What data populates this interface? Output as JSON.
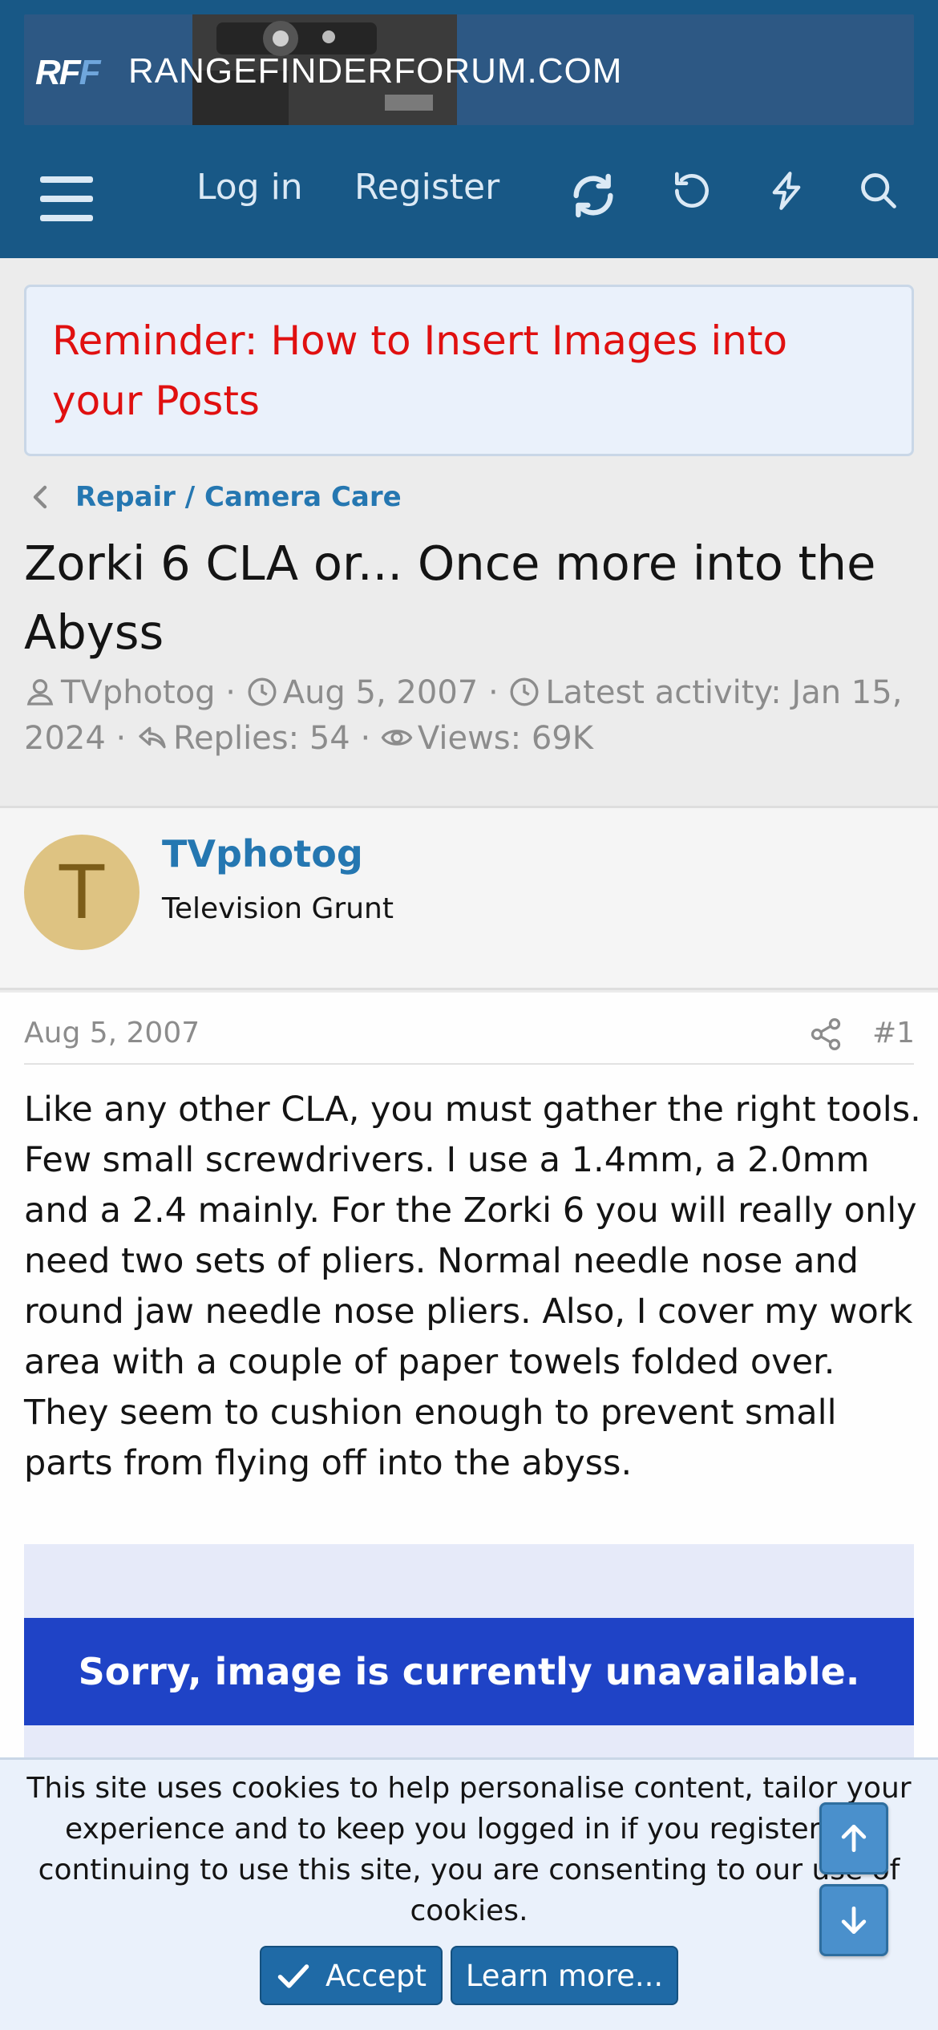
{
  "site": {
    "logo_text_r": "RF",
    "logo_text_f": "F",
    "name": "RANGEFINDERFORUM.COM"
  },
  "nav": {
    "login_label": "Log in",
    "register_label": "Register",
    "icons": [
      "menu-icon",
      "refresh-icon",
      "undo-icon",
      "bolt-icon",
      "search-icon"
    ]
  },
  "notice": {
    "text": "Reminder: How to Insert Images into your Posts"
  },
  "breadcrumb": {
    "label": "Repair / Camera Care"
  },
  "thread": {
    "title": "Zorki 6 CLA or... Once more into the Abyss",
    "author": "TVphotog",
    "start_date": "Aug 5, 2007",
    "latest_activity": "Latest activity: Jan 15, 2024",
    "replies": "Replies: 54",
    "views": "Views: 69K",
    "sep": "·"
  },
  "author_block": {
    "avatar_letter": "T",
    "username": "TVphotog",
    "user_title": "Television Grunt"
  },
  "post": {
    "date": "Aug 5, 2007",
    "number": "#1",
    "body": "Like any other CLA, you must gather the right tools. Few small screwdrivers. I use a 1.4mm, a 2.0mm and a 2.4 mainly. For the Zorki 6 you will really only need two sets of pliers. Normal needle nose and round jaw needle nose pliers. Also, I cover my work area with a couple of paper towels folded over. They seem to cushion enough to prevent small parts from flying off into the abyss.",
    "image_text": "Sorry, image is currently unavailable."
  },
  "cookie": {
    "text": "This site uses cookies to help personalise content, tailor your experience and to keep you logged in if you register. By continuing to use this site, you are consenting to our use of cookies.",
    "accept_label": "Accept",
    "learn_more_label": "Learn more..."
  },
  "colors": {
    "header_bg": "#185886",
    "link": "#2577b1",
    "notice_red": "#e01010",
    "button": "#1f6aa6"
  }
}
